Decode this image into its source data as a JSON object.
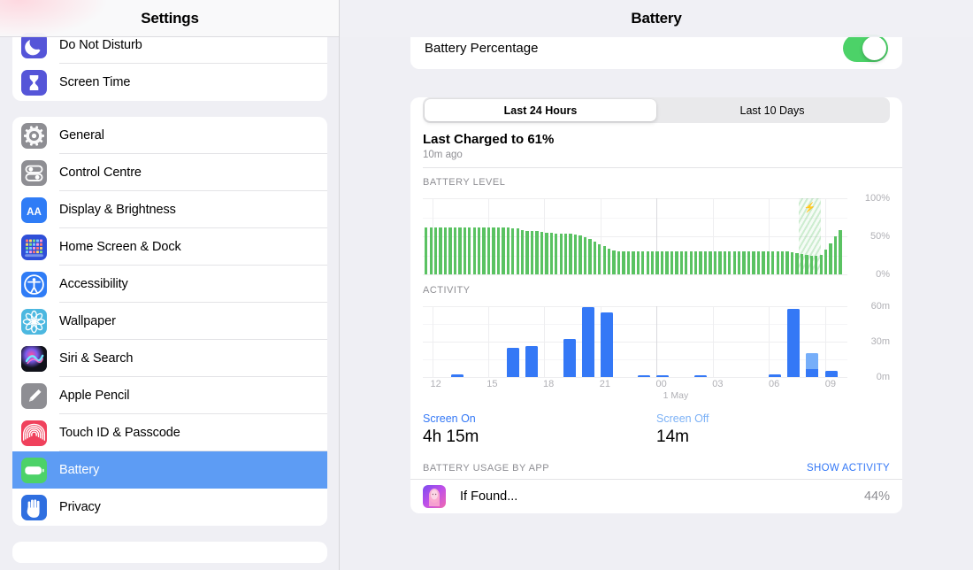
{
  "sidebar": {
    "header_title": "Settings",
    "group_top": [
      {
        "label": "Do Not Disturb",
        "icon": "moon-icon",
        "icon_bg": "#5555d8"
      },
      {
        "label": "Screen Time",
        "icon": "hourglass-icon",
        "icon_bg": "#5555d8"
      }
    ],
    "group_main": [
      {
        "label": "General",
        "icon": "gear-icon",
        "icon_bg": "#8e8e93"
      },
      {
        "label": "Control Centre",
        "icon": "sliders-icon",
        "icon_bg": "#8e8e93"
      },
      {
        "label": "Display & Brightness",
        "icon": "aa-icon",
        "icon_bg": "#2f7cf6"
      },
      {
        "label": "Home Screen & Dock",
        "icon": "app-grid-icon",
        "icon_bg": "#2f4fd8"
      },
      {
        "label": "Accessibility",
        "icon": "accessibility-icon",
        "icon_bg": "#2f7cf6"
      },
      {
        "label": "Wallpaper",
        "icon": "flower-icon",
        "icon_bg": "#4cb8e0"
      },
      {
        "label": "Siri & Search",
        "icon": "siri-icon",
        "icon_bg": "#1b1b1f"
      },
      {
        "label": "Apple Pencil",
        "icon": "pencil-icon",
        "icon_bg": "#8e8e93"
      },
      {
        "label": "Touch ID & Passcode",
        "icon": "fingerprint-icon",
        "icon_bg": "#f0415c"
      },
      {
        "label": "Battery",
        "icon": "battery-icon",
        "icon_bg": "#4cd268",
        "selected": true
      },
      {
        "label": "Privacy",
        "icon": "hand-icon",
        "icon_bg": "#2f6fe0"
      }
    ],
    "selected_color": "#5d9cf4"
  },
  "main": {
    "header_title": "Battery",
    "battery_percentage": {
      "label": "Battery Percentage",
      "enabled": true,
      "on_color": "#4cd268"
    },
    "segmented": {
      "options": [
        "Last 24 Hours",
        "Last 10 Days"
      ],
      "selected_index": 0
    },
    "last_charged": {
      "title": "Last Charged to 61%",
      "subtitle": "10m ago"
    },
    "screen_on": {
      "label": "Screen On",
      "value": "4h 15m"
    },
    "screen_off": {
      "label": "Screen Off",
      "value": "14m"
    },
    "usage": {
      "section_label": "BATTERY USAGE BY APP",
      "action_label": "SHOW ACTIVITY",
      "apps": [
        {
          "name": "If Found...",
          "percent": "44%"
        }
      ]
    }
  },
  "chart_data": [
    {
      "type": "bar",
      "title": "BATTERY LEVEL",
      "ylabel": "",
      "xlabel": "",
      "ylim": [
        0,
        100
      ],
      "ytick_labels": [
        "100%",
        "50%",
        "0%"
      ],
      "ytick_values": [
        100,
        50,
        0
      ],
      "xtick_labels": [
        "12",
        "15",
        "18",
        "21",
        "00",
        "03",
        "06",
        "09"
      ],
      "xtick_values": [
        12,
        15,
        18,
        21,
        24,
        27,
        30,
        33
      ],
      "x_range": [
        11.5,
        34.2
      ],
      "day_divider_at": 24,
      "day_divider_label": "1 May",
      "bar_color": "#5ac262",
      "grid": true,
      "charging_region": {
        "start": 31.6,
        "end": 32.8,
        "icon": "bolt-icon"
      },
      "values": [
        62,
        62,
        62,
        62,
        62,
        62,
        62,
        62,
        62,
        62,
        62,
        62,
        62,
        62,
        62,
        62,
        62,
        62,
        61,
        60,
        58,
        57,
        57,
        57,
        56,
        55,
        55,
        54,
        54,
        53,
        53,
        52,
        51,
        49,
        46,
        43,
        40,
        37,
        34,
        31,
        30,
        30,
        30,
        30,
        30,
        30,
        30,
        30,
        30,
        30,
        30,
        30,
        30,
        30,
        30,
        30,
        30,
        30,
        30,
        30,
        30,
        30,
        30,
        30,
        30,
        30,
        30,
        30,
        30,
        30,
        30,
        30,
        30,
        30,
        30,
        30,
        29,
        28,
        27,
        26,
        25,
        24,
        26,
        33,
        41,
        50,
        58
      ]
    },
    {
      "type": "bar",
      "title": "ACTIVITY",
      "stacked": true,
      "ylim": [
        0,
        60
      ],
      "ytick_labels": [
        "60m",
        "30m",
        "0m"
      ],
      "ytick_values": [
        60,
        30,
        0
      ],
      "xtick_labels": [
        "12",
        "15",
        "18",
        "21",
        "00",
        "03",
        "06",
        "09"
      ],
      "xtick_values": [
        12,
        15,
        18,
        21,
        24,
        27,
        30,
        33
      ],
      "x_range": [
        11.5,
        34.2
      ],
      "day_divider_at": 24,
      "day_divider_label": "1 May",
      "grid": true,
      "series": [
        {
          "name": "Screen On",
          "color": "#3478f6",
          "hours": [
            12,
            13,
            14,
            15,
            16,
            17,
            18,
            19,
            20,
            21,
            22,
            23,
            0,
            1,
            2,
            3,
            4,
            5,
            6,
            7,
            8,
            9,
            10
          ],
          "values": [
            0,
            2,
            0,
            0,
            25,
            26,
            0,
            32,
            59,
            55,
            0,
            1,
            1,
            0,
            1,
            0,
            0,
            0,
            2,
            58,
            7,
            5,
            0
          ]
        },
        {
          "name": "Screen Off",
          "color": "#76aef9",
          "hours": [
            12,
            13,
            14,
            15,
            16,
            17,
            18,
            19,
            20,
            21,
            22,
            23,
            0,
            1,
            2,
            3,
            4,
            5,
            6,
            7,
            8,
            9,
            10
          ],
          "values": [
            0,
            0,
            0,
            0,
            0,
            0,
            0,
            0,
            0,
            0,
            0,
            0,
            0,
            0,
            0,
            0,
            0,
            0,
            0,
            0,
            13,
            0,
            0
          ]
        }
      ]
    }
  ]
}
